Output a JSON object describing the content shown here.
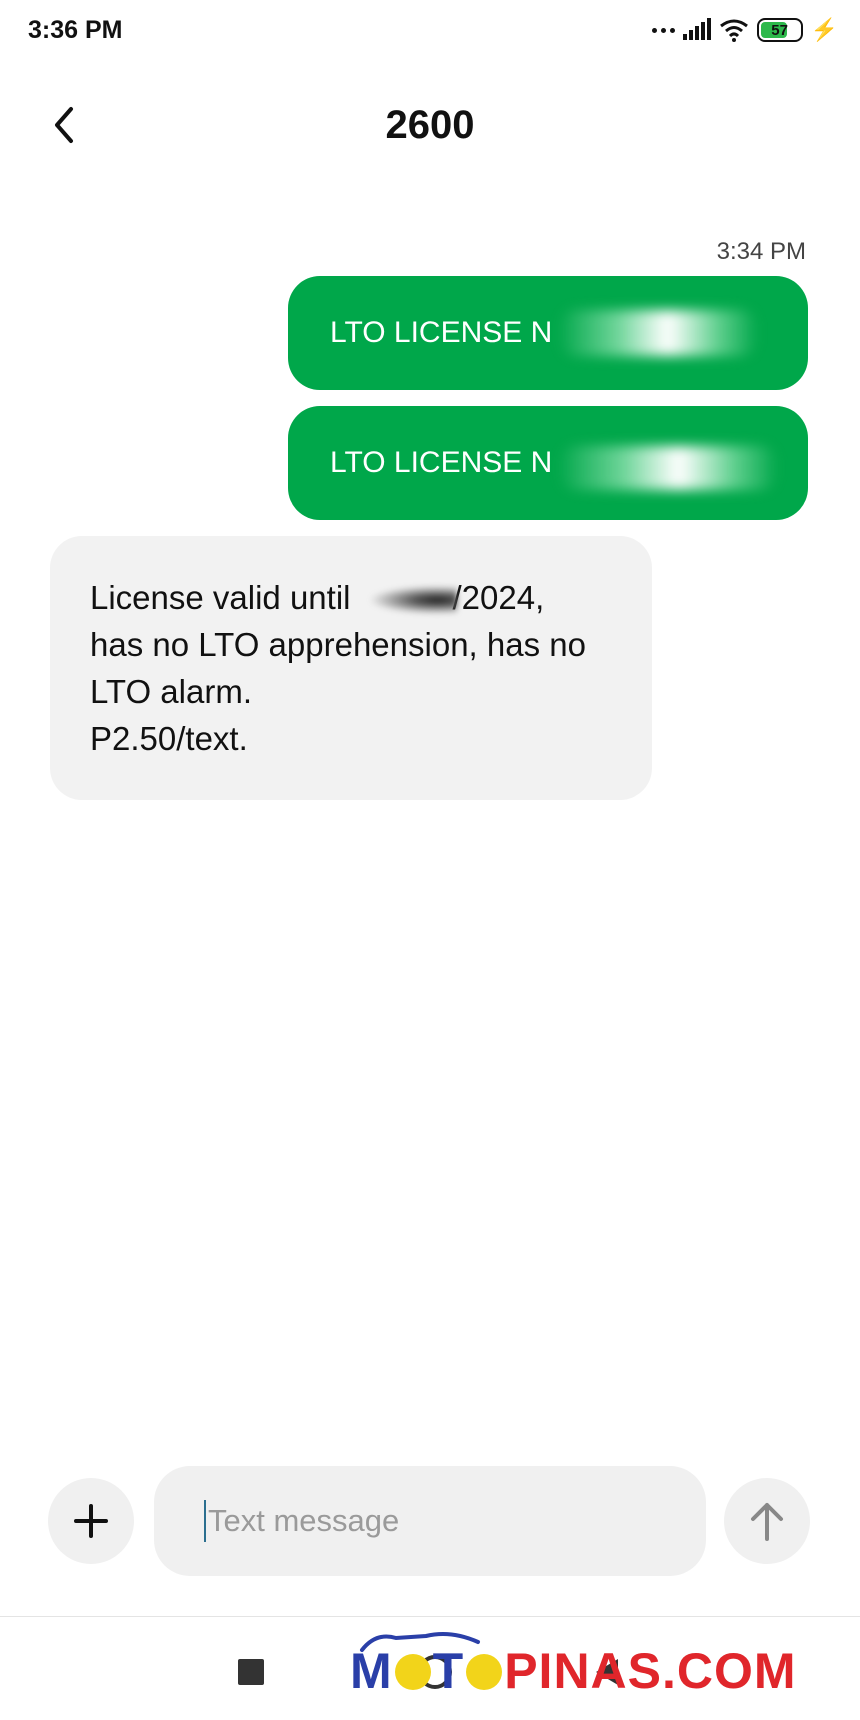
{
  "status_bar": {
    "time": "3:36 PM",
    "battery": "57",
    "icons": [
      "more-dots-icon",
      "signal-icon",
      "wifi-icon",
      "battery-icon",
      "charging-bolt-icon"
    ]
  },
  "header": {
    "title": "2600",
    "back_icon": "chevron-left-icon"
  },
  "messages": {
    "timestamp": "3:34 PM",
    "outgoing": [
      {
        "text": "LTO LICENSE N"
      },
      {
        "text": "LTO LICENSE N"
      }
    ],
    "incoming": {
      "line1_prefix": "License valid until",
      "line1_suffix": "/2024,",
      "line2": "has no LTO apprehension, has no",
      "line3": "LTO alarm.",
      "line4": "P2.50/text."
    },
    "colors": {
      "outgoing_bubble": "#00a74a",
      "incoming_bubble": "#f2f2f2"
    }
  },
  "composer": {
    "placeholder": "Text message",
    "add_icon": "plus-icon",
    "send_icon": "arrow-up-icon"
  },
  "nav_bar": {
    "icons": [
      "recents-square-icon",
      "home-circle-icon",
      "back-triangle-icon"
    ]
  },
  "watermark": {
    "part1": "M",
    "part2": "T",
    "part3": "PINAS.COM",
    "colors": {
      "blue": "#2a3fa8",
      "red": "#e0262b",
      "yellow": "#f2d41a"
    }
  }
}
